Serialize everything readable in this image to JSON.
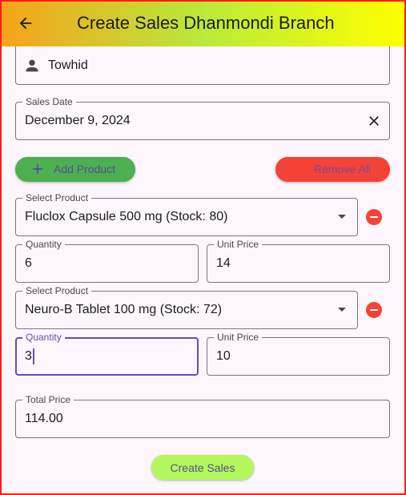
{
  "appbar": {
    "title": "Create Sales Dhanmondi Branch",
    "back_icon": "arrow-back-icon",
    "gradient": [
      "#f7a21a",
      "#b9e93a",
      "#ffff00"
    ]
  },
  "customer": {
    "value": "Towhid",
    "icon": "person-icon"
  },
  "sales_date": {
    "label": "Sales Date",
    "value": "December 9, 2024",
    "clear_icon": "close-icon"
  },
  "buttons": {
    "add_product": "Add Product",
    "remove_all": "Remove All",
    "create_sales": "Create Sales",
    "add_color": "#4caf50",
    "remove_color": "#f44336",
    "create_color": "#b2f85a"
  },
  "products": [
    {
      "select_label": "Select Product",
      "product": "Fluclox Capsule 500 mg (Stock: 80)",
      "quantity_label": "Quantity",
      "quantity": "6",
      "unit_price_label": "Unit Price",
      "unit_price": "14"
    },
    {
      "select_label": "Select Product",
      "product": "Neuro-B Tablet 100 mg (Stock: 72)",
      "quantity_label": "Quantity",
      "quantity": "3",
      "unit_price_label": "Unit Price",
      "unit_price": "10"
    }
  ],
  "total": {
    "label": "Total Price",
    "value": "114.00"
  }
}
